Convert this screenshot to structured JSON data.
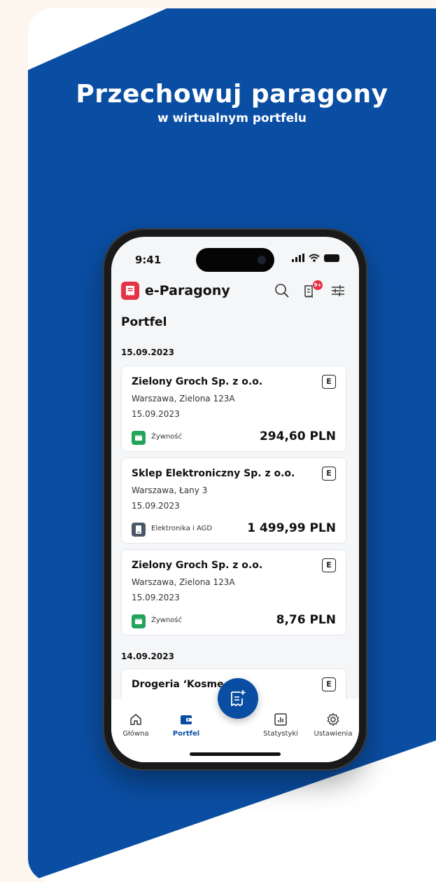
{
  "headline": {
    "title": "Przechowuj paragony",
    "subtitle": "w wirtualnym portfelu"
  },
  "colors": {
    "brand_blue": "#0a4ea3",
    "accent_red": "#e53245",
    "food_green": "#22a45a",
    "electronics_slate": "#4a5868",
    "page_bg": "#fdf6ee"
  },
  "status": {
    "time": "9:41"
  },
  "app": {
    "title": "e-Paragony",
    "badge_count": "9+",
    "page_title": "Portfel"
  },
  "groups": [
    {
      "date": "15.09.2023",
      "receipts": [
        {
          "name": "Zielony Groch Sp. z o.o.",
          "address": "Warszawa, Zielona 123A",
          "date": "15.09.2023",
          "badge": "E",
          "category": "Żywność",
          "category_icon": "grocery-icon",
          "amount": "294,60 PLN"
        },
        {
          "name": "Sklep Elektroniczny Sp. z o.o.",
          "address": "Warszawa, Łany 3",
          "date": "15.09.2023",
          "badge": "E",
          "category": "Elektronika i AGD",
          "category_icon": "device-icon",
          "amount": "1 499,99 PLN"
        },
        {
          "name": "Zielony Groch Sp. z o.o.",
          "address": "Warszawa, Zielona 123A",
          "date": "15.09.2023",
          "badge": "E",
          "category": "Żywność",
          "category_icon": "grocery-icon",
          "amount": "8,76 PLN"
        }
      ]
    },
    {
      "date": "14.09.2023",
      "receipts": [
        {
          "name": "Drogeria ‘Kosme",
          "badge": "E"
        }
      ]
    }
  ],
  "nav": {
    "items": [
      {
        "label": "Główna",
        "icon": "home-icon"
      },
      {
        "label": "Portfel",
        "icon": "wallet-icon",
        "active": true
      },
      {
        "label": "Statystyki",
        "icon": "stats-icon"
      },
      {
        "label": "Ustawienia",
        "icon": "gear-icon"
      }
    ],
    "fab_icon": "add-receipt-icon"
  }
}
